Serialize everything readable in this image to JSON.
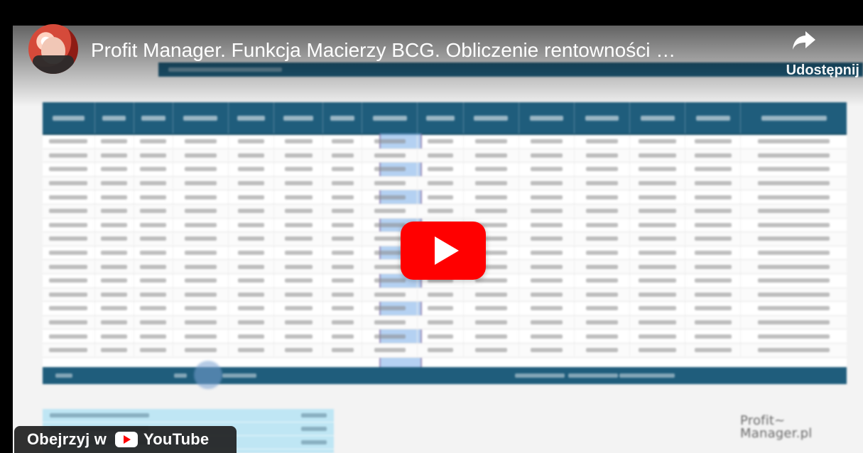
{
  "overlay": {
    "title": "Profit Manager. Funkcja Macierzy BCG. Obliczenie rentowności …",
    "share_label": "Udostępnij",
    "watch_on_label": "Obejrzyj w",
    "youtube_label": "YouTube"
  },
  "icons": {
    "share": "share-icon",
    "play": "play-icon",
    "youtube": "youtube-logo-icon"
  },
  "video_content": {
    "logo_text": "Profit~\nManager.pl"
  },
  "colors": {
    "accent_red": "#ff0000",
    "sheet_header": "#1f5d7c",
    "sheet_highlight": "#8cb9eb",
    "mini_table": "#bfe6f4"
  }
}
